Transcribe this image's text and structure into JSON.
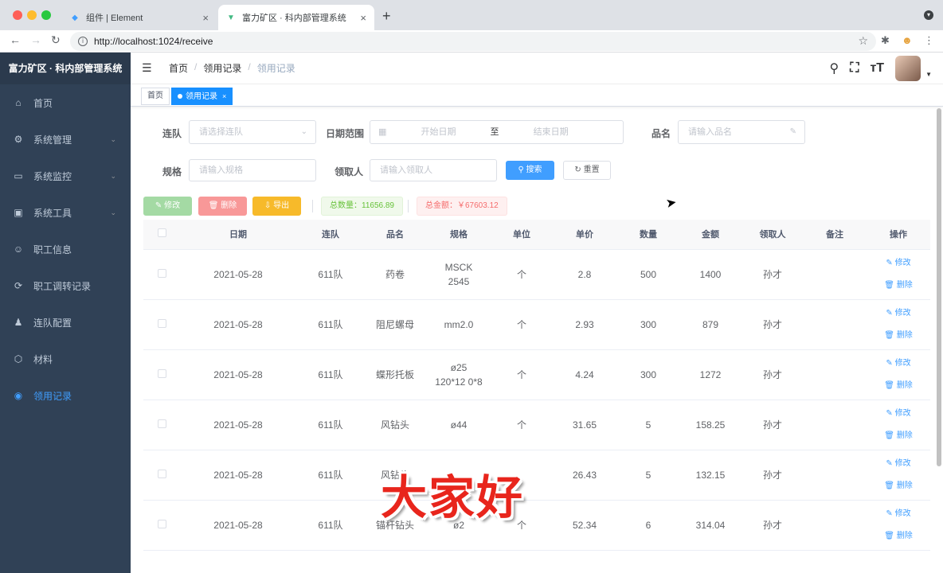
{
  "browser": {
    "tabs": [
      {
        "title": "组件 | Element",
        "active": false
      },
      {
        "title": "富力矿区 · 科内部管理系统",
        "active": true
      }
    ],
    "url": "http://localhost:1024/receive"
  },
  "sidebar": {
    "title": "富力矿区 · 科内部管理系统",
    "items": [
      {
        "label": "首页",
        "icon": "home-icon",
        "glyph": "⌂",
        "has_children": false,
        "active": false
      },
      {
        "label": "系统管理",
        "icon": "gear-icon",
        "glyph": "⚙",
        "has_children": true,
        "active": false
      },
      {
        "label": "系统监控",
        "icon": "monitor-icon",
        "glyph": "▭",
        "has_children": true,
        "active": false
      },
      {
        "label": "系统工具",
        "icon": "toolbox-icon",
        "glyph": "▣",
        "has_children": true,
        "active": false
      },
      {
        "label": "职工信息",
        "icon": "people-icon",
        "glyph": "☺",
        "has_children": false,
        "active": false
      },
      {
        "label": "职工调转记录",
        "icon": "transfer-icon",
        "glyph": "⟳",
        "has_children": false,
        "active": false
      },
      {
        "label": "连队配置",
        "icon": "user-icon",
        "glyph": "♟",
        "has_children": false,
        "active": false
      },
      {
        "label": "材料",
        "icon": "material-icon",
        "glyph": "⬡",
        "has_children": false,
        "active": false
      },
      {
        "label": "领用记录",
        "icon": "record-icon",
        "glyph": "◉",
        "has_children": false,
        "active": true
      }
    ]
  },
  "header": {
    "breadcrumb": [
      "首页",
      "领用记录",
      "领用记录"
    ]
  },
  "tags": [
    {
      "label": "首页",
      "active": false
    },
    {
      "label": "领用记录",
      "active": true
    }
  ],
  "filters": {
    "team_label": "连队",
    "team_placeholder": "请选择连队",
    "date_label": "日期范围",
    "date_start_placeholder": "开始日期",
    "date_sep": "至",
    "date_end_placeholder": "结束日期",
    "name_label": "品名",
    "name_placeholder": "请输入品名",
    "spec_label": "规格",
    "spec_placeholder": "请输入规格",
    "receiver_label": "领取人",
    "receiver_placeholder": "请输入领取人",
    "search_button": "搜索",
    "reset_button": "重置"
  },
  "toolbar": {
    "edit_button": "修改",
    "delete_button": "删除",
    "export_button": "导出",
    "total_qty": "总数量：11656.89",
    "total_amount": "总金额：￥67603.12"
  },
  "table": {
    "columns": [
      "日期",
      "连队",
      "品名",
      "规格",
      "单位",
      "单价",
      "数量",
      "金额",
      "领取人",
      "备注",
      "操作"
    ],
    "edit_label": "修改",
    "delete_label": "删除",
    "rows": [
      {
        "date": "2021-05-28",
        "team": "611队",
        "name": "药卷",
        "spec": "MSCK 2545",
        "unit": "个",
        "price": "2.8",
        "qty": "500",
        "amount": "1400",
        "receiver": "孙才",
        "remark": ""
      },
      {
        "date": "2021-05-28",
        "team": "611队",
        "name": "阻尼螺母",
        "spec": "mm2.0",
        "unit": "个",
        "price": "2.93",
        "qty": "300",
        "amount": "879",
        "receiver": "孙才",
        "remark": ""
      },
      {
        "date": "2021-05-28",
        "team": "611队",
        "name": "蝶形托板",
        "spec": "ø25 120*12 0*8",
        "unit": "个",
        "price": "4.24",
        "qty": "300",
        "amount": "1272",
        "receiver": "孙才",
        "remark": ""
      },
      {
        "date": "2021-05-28",
        "team": "611队",
        "name": "风钻头",
        "spec": "ø44",
        "unit": "个",
        "price": "31.65",
        "qty": "5",
        "amount": "158.25",
        "receiver": "孙才",
        "remark": ""
      },
      {
        "date": "2021-05-28",
        "team": "611队",
        "name": "风钻头",
        "spec": "",
        "unit": "",
        "price": "26.43",
        "qty": "5",
        "amount": "132.15",
        "receiver": "孙才",
        "remark": ""
      },
      {
        "date": "2021-05-28",
        "team": "611队",
        "name": "锚杆钻头",
        "spec": "ø2",
        "unit": "个",
        "price": "52.34",
        "qty": "6",
        "amount": "314.04",
        "receiver": "孙才",
        "remark": ""
      }
    ]
  },
  "overlay_caption": "大家好",
  "colors": {
    "sidebar_bg": "#304156",
    "primary": "#409eff",
    "success": "#67c23a",
    "danger": "#f56c6c",
    "warning": "#f7ba2a"
  }
}
